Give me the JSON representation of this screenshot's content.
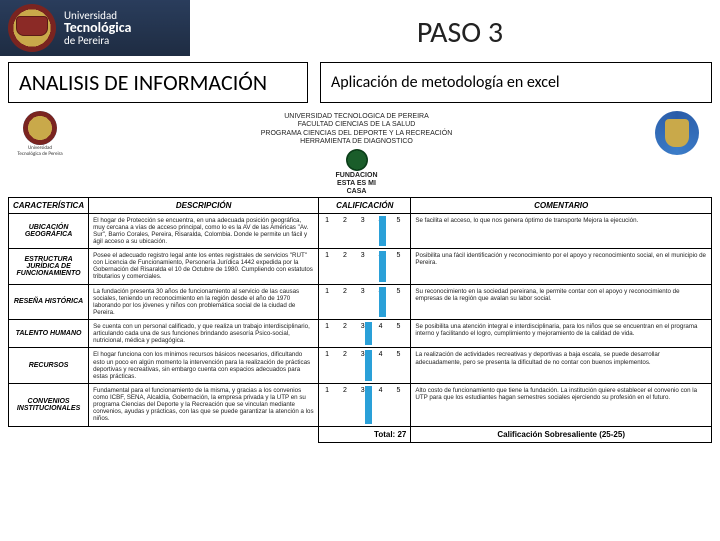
{
  "header": {
    "university_line1": "Universidad",
    "university_line2": "Tecnológica",
    "university_line3": "de Pereira",
    "step_title": "PASO 3"
  },
  "subheader": {
    "left_box": "ANALISIS DE INFORMACIÓN",
    "right_box": "Aplicación de metodología en excel"
  },
  "doc_header": {
    "line1": "UNIVERSIDAD TECNOLOGICA DE PEREIRA",
    "line2": "FACULTAD CIENCIAS DE LA SALUD",
    "line3": "PROGRAMA CIENCIAS DEL DEPORTE Y LA RECREACIÓN",
    "line4": "HERRAMIENTA DE DIAGNOSTICO",
    "crest_caption": "Universidad Tecnológica de Pereira",
    "foundation_l1": "FUNDACION",
    "foundation_l2": "ESTA ES MI",
    "foundation_l3": "CASA"
  },
  "columns": {
    "c1": "CARACTERÍSTICA",
    "c2": "DESCRIPCIÓN",
    "c3": "CALIFICACIÓN",
    "c4": "COMENTARIO"
  },
  "rows": [
    {
      "head": "UBICACIÓN GEOGRÁFICA",
      "desc": "El hogar de Protección se encuentra, en una adecuada posición geográfica, muy cercana a vías de acceso principal, como lo es la AV de las Américas \"Av. Sur\", Barrio Corales, Pereira, Risaralda, Colombia. Donde le permite un fácil y ágil acceso a su ubicación.",
      "cal": "1   2   3   4   5",
      "hl_index": 4,
      "com": "Se facilita el acceso, lo que nos genera óptimo de transporte Mejora la ejecución."
    },
    {
      "head": "ESTRUCTURA JURÍDICA DE FUNCIONAMIENTO",
      "desc": "Posee el adecuado registro legal ante los entes registrales de servicios \"RUT\" con Licencia de Funcionamiento, Personería Jurídica 1442 expedida por la Gobernación del Risaralda el 10 de Octubre de 1980. Cumpliendo con estatutos tributarios y comerciales.",
      "cal": "1   2   3   4   5",
      "hl_index": 4,
      "com": "Posibilita una fácil identificación y reconocimiento por el apoyo y reconocimiento social, en el municipio de Pereira."
    },
    {
      "head": "RESEÑA HISTÓRICA",
      "desc": "La fundación presenta 30 años de funcionamiento al servicio de las causas sociales, teniendo un reconocimiento en la región desde el año de 1970 laborando por los jóvenes y niños con problemática social de la ciudad de Pereira.",
      "cal": "1   2   3   4   5",
      "hl_index": 4,
      "com": "Su reconocimiento en la sociedad pereirana, le permite contar con el apoyo y reconocimiento de empresas de la región que avalan su labor social."
    },
    {
      "head": "TALENTO HUMANO",
      "desc": "Se cuenta con un personal calificado, y que realiza un trabajo interdisciplinario, articulando cada una de sus funciones brindando asesoría Psico-social, nutricional, médica y pedagógica.",
      "cal": "1   2   3   4   5",
      "hl_index": 3,
      "com": "Se posibilita una atención integral e interdisciplinaria, para los niños que se encuentran en el programa interno y facilitando el logro, cumplimiento y mejoramiento de la calidad de vida."
    },
    {
      "head": "RECURSOS",
      "desc": "El hogar funciona con los mínimos recursos básicos necesarios, dificultando esto un poco en algún momento la intervención para la realización de prácticas deportivas y recreativas, sin embargo cuenta con espacios adecuados para estas prácticas.",
      "cal": "1   2   3   4   5",
      "hl_index": 3,
      "com": "La realización de actividades recreativas y deportivas a baja escala, se puede desarrollar adecuadamente, pero se presenta la dificultad de no contar con buenos implementos."
    },
    {
      "head": "CONVENIOS INSTITUCIONALES",
      "desc": "Fundamental para el funcionamiento de la misma, y gracias a los convenios como ICBF, SENA, Alcaldía, Gobernación, la empresa privada y la UTP en su programa Ciencias del Deporte y la Recreación que se vinculan mediante convenios, ayudas y prácticas, con las que se puede garantizar la atención a los niños.",
      "cal": "1   2   3   4   5",
      "hl_index": 3,
      "com": "Alto costo de funcionamiento que tiene la fundación. La institución quiere establecer el convenio con la UTP para que los estudiantes hagan semestres sociales ejerciendo su profesión en el futuro."
    }
  ],
  "footer": {
    "total_label": "Total:",
    "total_value": "27",
    "rating_box": "Calificación Sobresaliente (25-25)"
  }
}
